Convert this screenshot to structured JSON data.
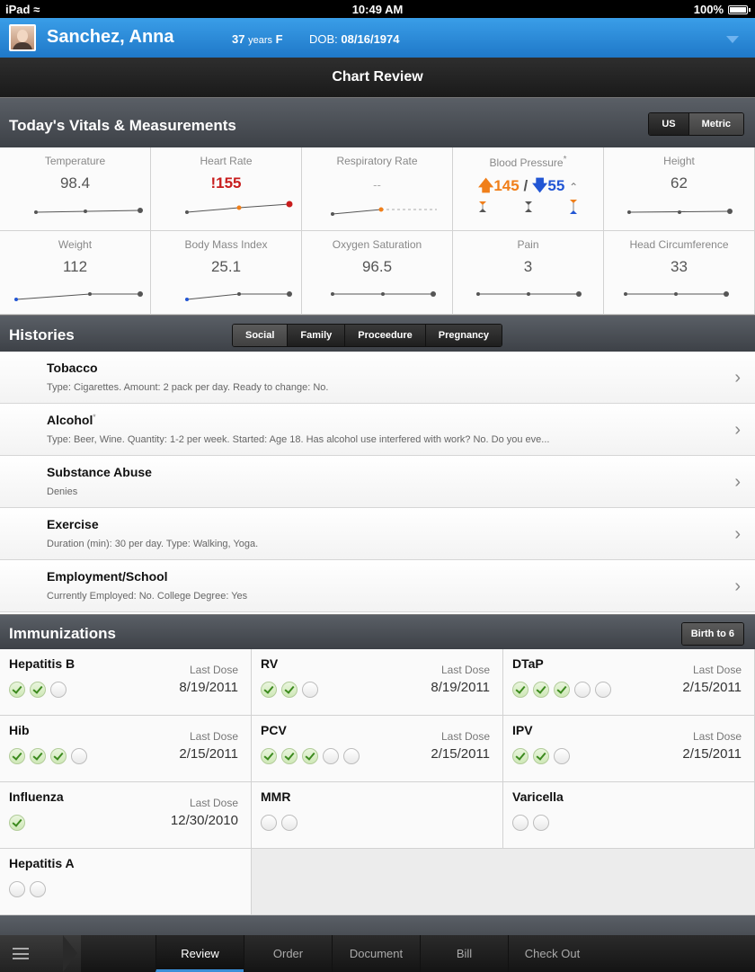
{
  "status_bar": {
    "device": "iPad",
    "time": "10:49 AM",
    "battery": "100%"
  },
  "patient": {
    "name": "Sanchez, Anna",
    "age_value": "37",
    "age_unit": "years",
    "sex": "F",
    "dob_label": "DOB:",
    "dob": "08/16/1974"
  },
  "page_title": "Chart Review",
  "vitals": {
    "title": "Today's Vitals & Measurements",
    "units": [
      "US",
      "Metric"
    ],
    "selected_unit": "Metric",
    "items": [
      {
        "label": "Temperature",
        "value": "98.4"
      },
      {
        "label": "Heart Rate",
        "value": "155",
        "alert_mark": "!"
      },
      {
        "label": "Respiratory Rate",
        "value": "--"
      },
      {
        "label": "Blood Pressure",
        "label_mark": "*",
        "systolic": "145",
        "separator": "/",
        "diastolic": "55"
      },
      {
        "label": "Height",
        "value": "62"
      },
      {
        "label": "Weight",
        "value": "112"
      },
      {
        "label": "Body Mass Index",
        "value": "25.1"
      },
      {
        "label": "Oxygen Saturation",
        "value": "96.5"
      },
      {
        "label": "Pain",
        "value": "3"
      },
      {
        "label": "Head Circumference",
        "value": "33"
      }
    ]
  },
  "histories": {
    "title": "Histories",
    "tabs": [
      "Social",
      "Family",
      "Proceedure",
      "Pregnancy"
    ],
    "selected_tab": "Social",
    "items": [
      {
        "title": "Tobacco",
        "detail": "Type: Cigarettes.  Amount: 2 pack per day.  Ready to change: No."
      },
      {
        "title": "Alcohol",
        "mark": "*",
        "detail": "Type: Beer, Wine.  Quantity: 1-2 per week.  Started: Age 18.  Has alcohol use interfered with work? No.  Do you eve..."
      },
      {
        "title": "Substance Abuse",
        "detail": "Denies"
      },
      {
        "title": "Exercise",
        "detail": "Duration (min): 30 per day.  Type: Walking, Yoga."
      },
      {
        "title": "Employment/School",
        "detail": "Currently Employed: No.  College Degree: Yes"
      }
    ]
  },
  "immunizations": {
    "title": "Immunizations",
    "range_button": "Birth to 6",
    "last_dose_label": "Last Dose",
    "items": [
      {
        "name": "Hepatitis B",
        "given": 2,
        "total": 3,
        "last_dose": "8/19/2011"
      },
      {
        "name": "RV",
        "given": 2,
        "total": 3,
        "last_dose": "8/19/2011"
      },
      {
        "name": "DTaP",
        "given": 3,
        "total": 5,
        "last_dose": "2/15/2011"
      },
      {
        "name": "Hib",
        "given": 3,
        "total": 4,
        "last_dose": "2/15/2011"
      },
      {
        "name": "PCV",
        "given": 3,
        "total": 5,
        "last_dose": "2/15/2011"
      },
      {
        "name": "IPV",
        "given": 2,
        "total": 3,
        "last_dose": "2/15/2011"
      },
      {
        "name": "Influenza",
        "given": 1,
        "total": 1,
        "last_dose": "12/30/2010"
      },
      {
        "name": "MMR",
        "given": 0,
        "total": 2,
        "last_dose": ""
      },
      {
        "name": "Varicella",
        "given": 0,
        "total": 2,
        "last_dose": ""
      },
      {
        "name": "Hepatitis A",
        "given": 0,
        "total": 2,
        "last_dose": ""
      }
    ]
  },
  "bottom_tabs": [
    "Review",
    "Order",
    "Document",
    "Bill",
    "Check Out"
  ],
  "active_tab": "Review",
  "colors": {
    "alert": "#c81d1d",
    "bp_up": "#f07f1a",
    "bp_down": "#2256d4",
    "accent": "#1f78c8"
  }
}
